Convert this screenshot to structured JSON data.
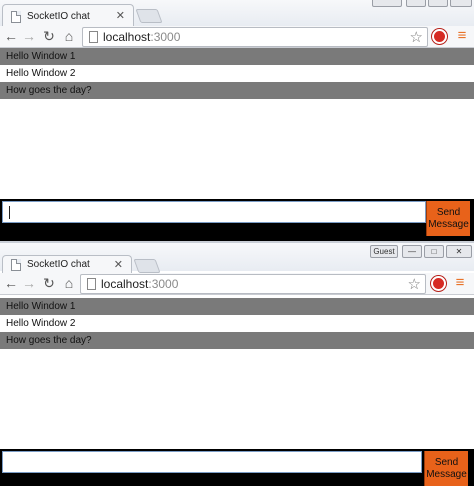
{
  "windows": [
    {
      "tab_title": "SocketIO chat",
      "tab_close": "✕",
      "url_host": "localhost",
      "url_port": ":3000",
      "messages": [
        "Hello Window 1",
        "Hello Window 2",
        "How goes the day?"
      ],
      "send_label_1": "Send",
      "send_label_2": "Message",
      "input_value": ""
    },
    {
      "tab_title": "SocketIO chat",
      "tab_close": "✕",
      "url_host": "localhost",
      "url_port": ":3000",
      "messages": [
        "Hello Window 1",
        "Hello Window 2",
        "How goes the day?"
      ],
      "send_label_1": "Send",
      "send_label_2": "Message",
      "input_value": ""
    }
  ],
  "icons": {
    "back": "back-arrow-icon",
    "forward": "forward-arrow-icon",
    "reload": "reload-icon",
    "home": "home-icon",
    "star": "bookmark-star-icon",
    "extension": "extension-icon",
    "menu": "menu-icon"
  },
  "colors": {
    "dark_row": "#7a7a7a",
    "send_button": "#e8621a",
    "menu_icon": "#e8732a",
    "extension_icon": "#d62a23"
  },
  "window_controls": {
    "user_label": "Guest",
    "minimize": "—",
    "maximize": "□",
    "close": "✕"
  }
}
